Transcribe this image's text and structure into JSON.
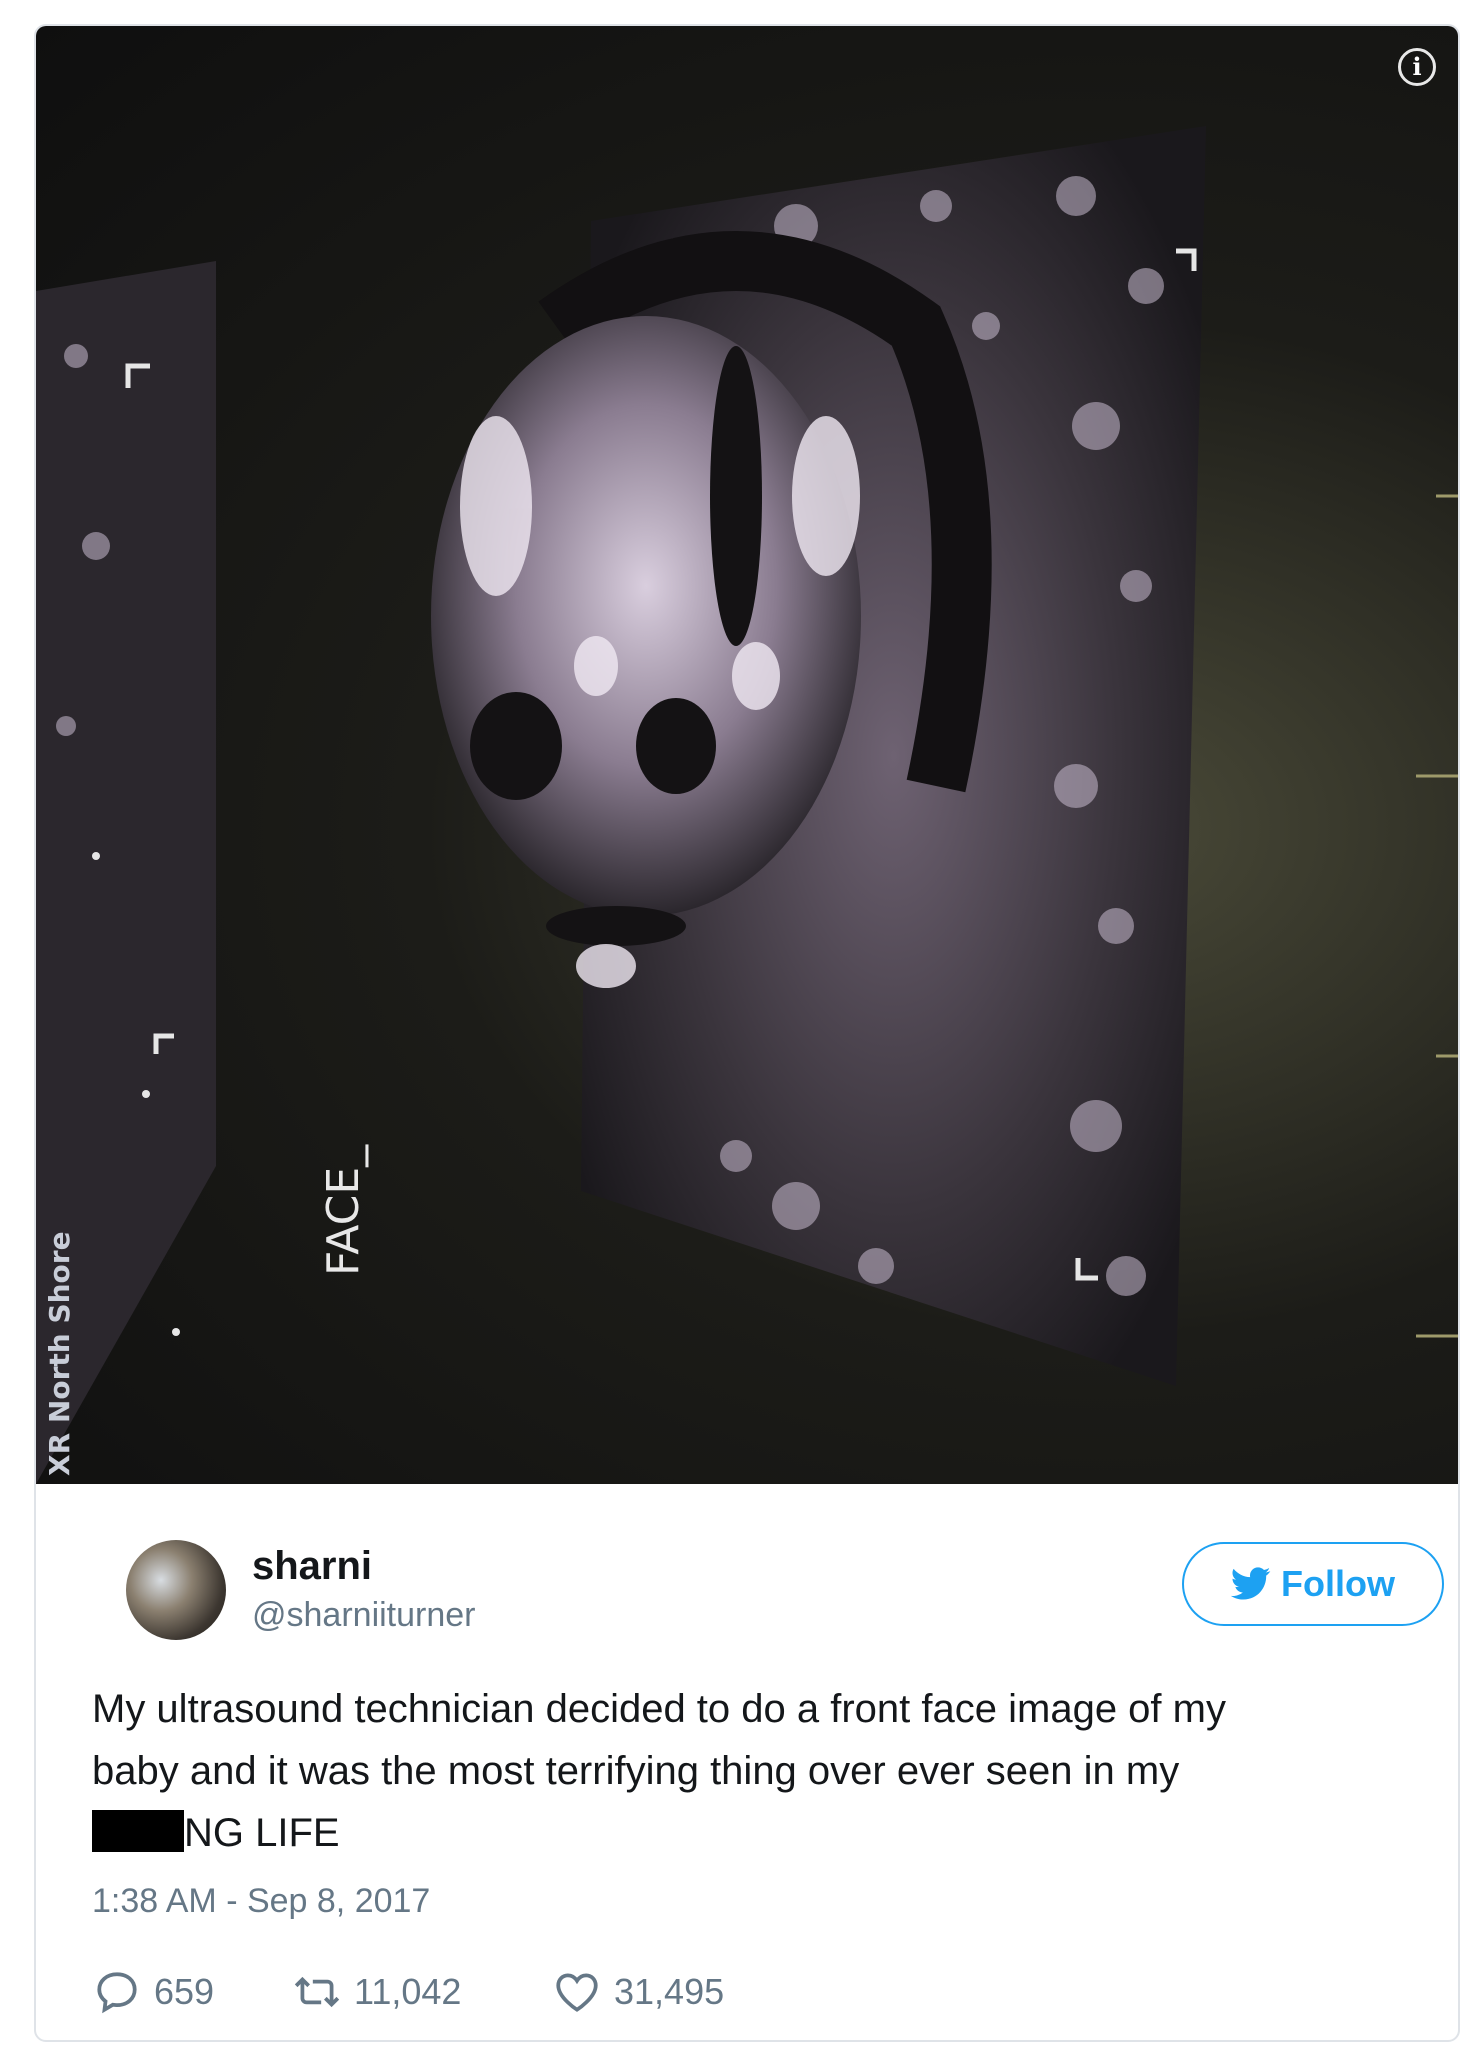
{
  "photo": {
    "side_label": "XR North Shore",
    "scan_label": "FACE_"
  },
  "tweet": {
    "name": "sharni",
    "handle": "@sharniiturner",
    "follow_label": "Follow",
    "text_line1": "My ultrasound technician decided to do a front face image of my",
    "text_line2": "baby and it was the most terrifying thing over ever seen in my",
    "text_line3_after_censor": "NG LIFE",
    "timestamp": "1:38 AM - Sep 8, 2017",
    "replies": "659",
    "retweets": "11,042",
    "likes": "31,495"
  },
  "icons": [
    "info-icon",
    "twitter-bird-icon",
    "reply-icon",
    "retweet-icon",
    "like-icon"
  ],
  "colors": {
    "accent": "#1da1f2",
    "text": "#14171a",
    "secondary_text": "#657786"
  }
}
